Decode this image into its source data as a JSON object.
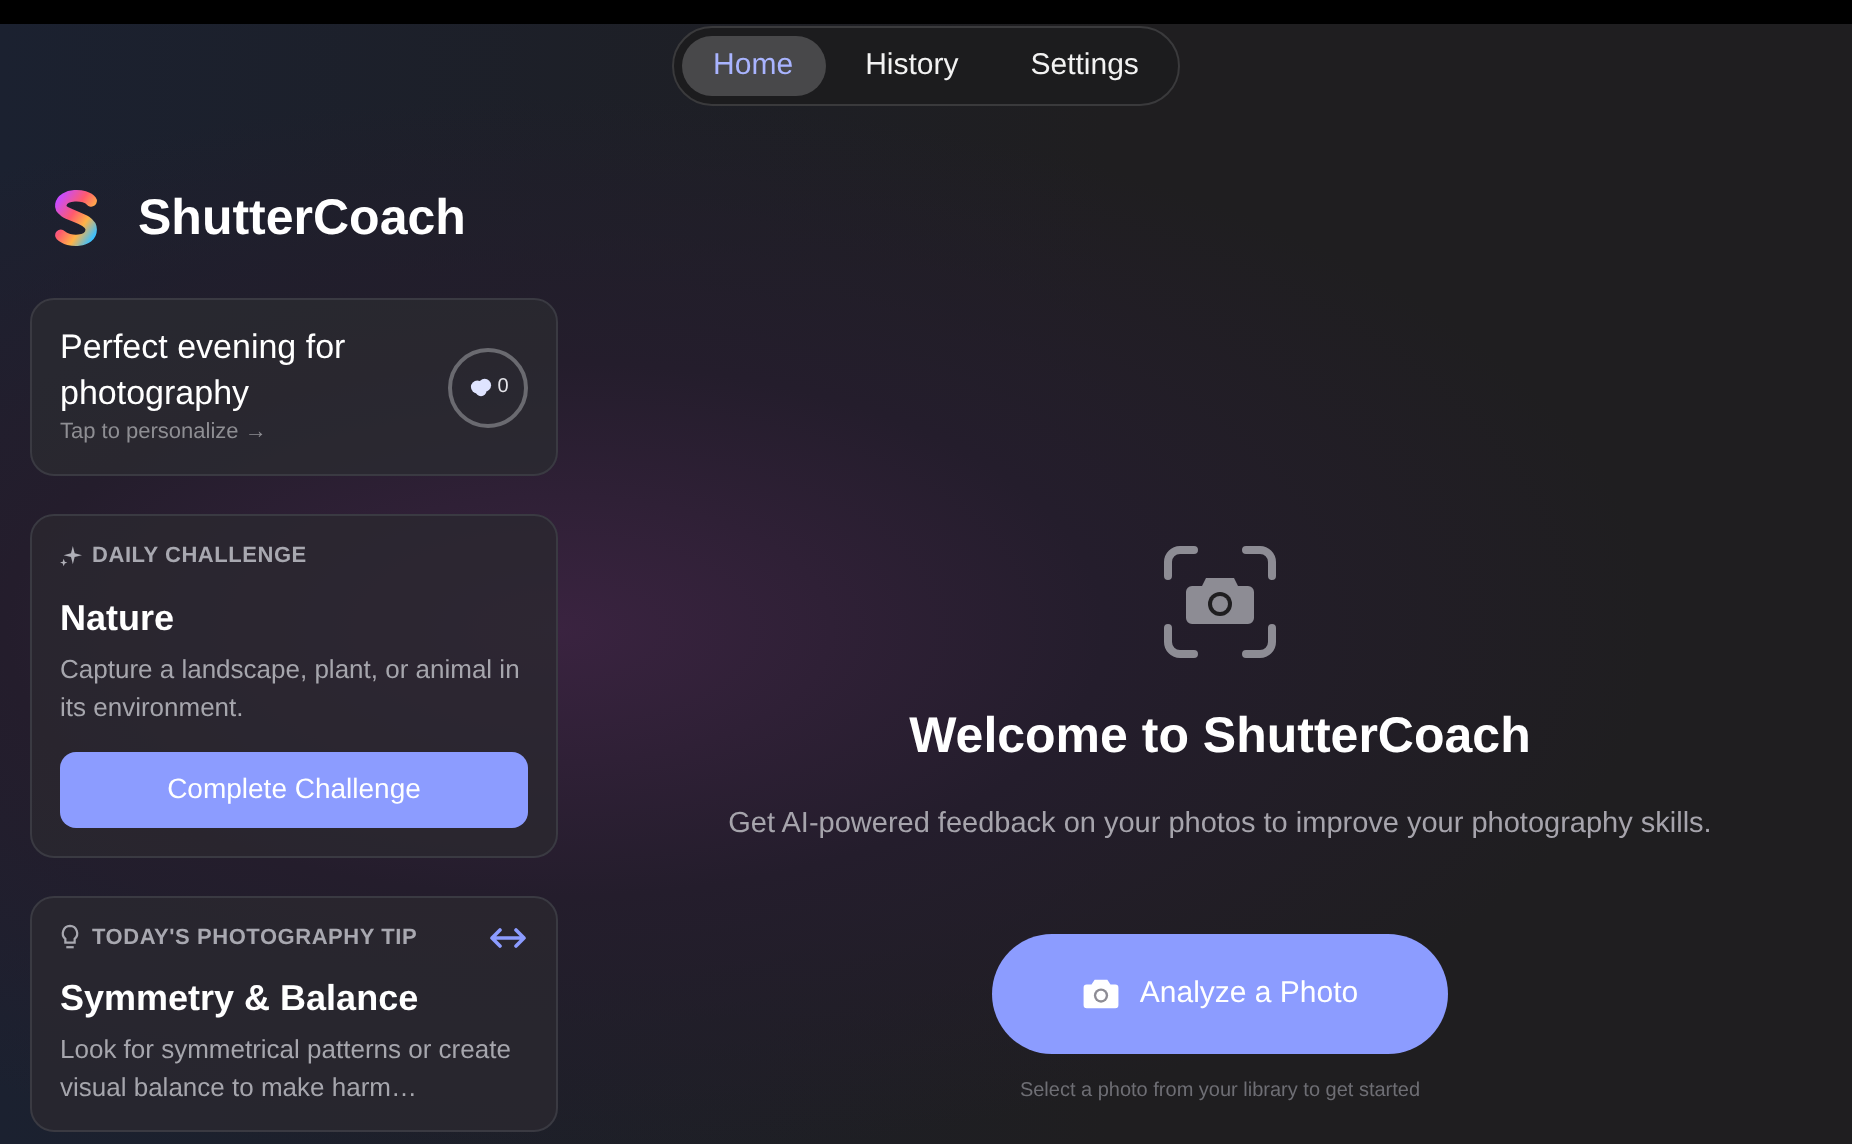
{
  "tabs": [
    {
      "label": "Home",
      "selected": true
    },
    {
      "label": "History",
      "selected": false
    },
    {
      "label": "Settings",
      "selected": false
    }
  ],
  "app": {
    "name": "ShutterCoach"
  },
  "weather_card": {
    "title": "Perfect evening for photography",
    "hint": "Tap to personalize →",
    "count": "0"
  },
  "challenge_card": {
    "label": "DAILY CHALLENGE",
    "title": "Nature",
    "description": "Capture a landscape, plant, or animal in its environment.",
    "button": "Complete Challenge"
  },
  "tip_card": {
    "label": "TODAY'S PHOTOGRAPHY TIP",
    "title": "Symmetry & Balance",
    "description": "Look for symmetrical patterns or create visual balance to make harm…"
  },
  "welcome": {
    "title": "Welcome to ShutterCoach",
    "subtitle": "Get AI-powered feedback on your photos to improve your photography skills.",
    "button": "Analyze a Photo",
    "hint": "Select a photo from your library to get started"
  }
}
